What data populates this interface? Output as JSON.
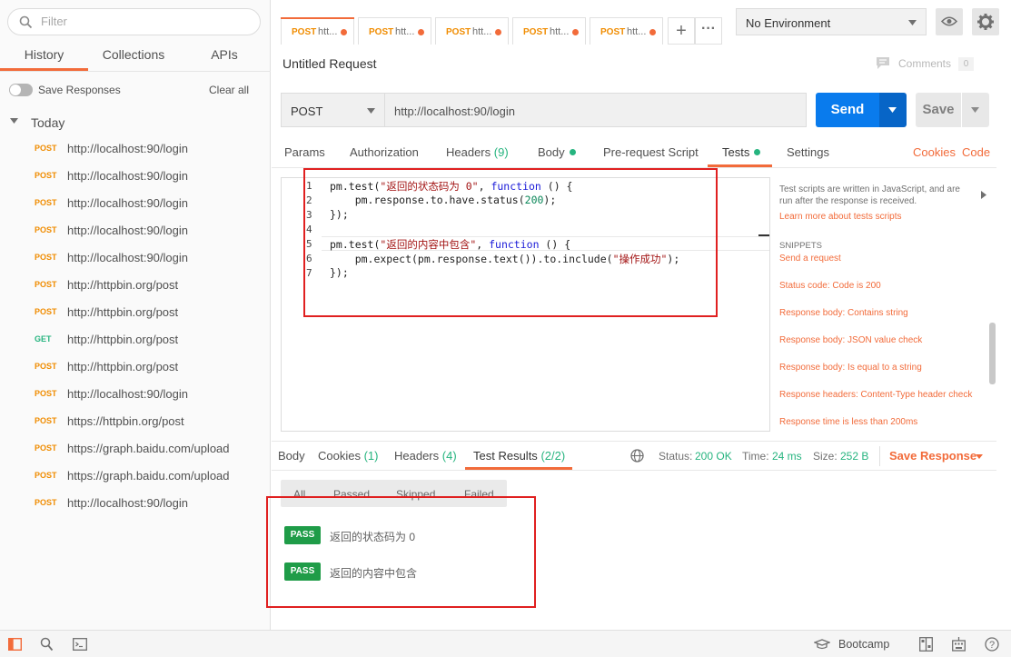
{
  "sidebar": {
    "filter_placeholder": "Filter",
    "tabs": [
      "History",
      "Collections",
      "APIs"
    ],
    "save_responses": "Save Responses",
    "clear_all": "Clear all",
    "group": "Today",
    "items": [
      {
        "method": "POST",
        "url": "http://localhost:90/login"
      },
      {
        "method": "POST",
        "url": "http://localhost:90/login"
      },
      {
        "method": "POST",
        "url": "http://localhost:90/login"
      },
      {
        "method": "POST",
        "url": "http://localhost:90/login"
      },
      {
        "method": "POST",
        "url": "http://localhost:90/login"
      },
      {
        "method": "POST",
        "url": "http://httpbin.org/post"
      },
      {
        "method": "POST",
        "url": "http://httpbin.org/post"
      },
      {
        "method": "GET",
        "url": "http://httpbin.org/post"
      },
      {
        "method": "POST",
        "url": "http://httpbin.org/post"
      },
      {
        "method": "POST",
        "url": "http://localhost:90/login"
      },
      {
        "method": "POST",
        "url": "https://httpbin.org/post"
      },
      {
        "method": "POST",
        "url": "https://graph.baidu.com/upload"
      },
      {
        "method": "POST",
        "url": "https://graph.baidu.com/upload"
      },
      {
        "method": "POST",
        "url": "http://localhost:90/login"
      }
    ]
  },
  "colors": {
    "post": "#f08c00",
    "get": "#26b47f",
    "accent": "#f26b3a",
    "send": "#097bed",
    "pass": "#1f9c48"
  },
  "tabs": [
    {
      "method": "POST",
      "label": "htt..."
    },
    {
      "method": "POST",
      "label": "htt..."
    },
    {
      "method": "POST",
      "label": "htt..."
    },
    {
      "method": "POST",
      "label": "htt..."
    },
    {
      "method": "POST",
      "label": "htt..."
    }
  ],
  "environment": "No Environment",
  "request": {
    "title": "Untitled Request",
    "comments": "Comments",
    "comments_count": "0",
    "method": "POST",
    "url": "http://localhost:90/login",
    "send": "Send",
    "save": "Save"
  },
  "request_tabs": {
    "params": "Params",
    "authorization": "Authorization",
    "headers": "Headers",
    "headers_count": "(9)",
    "body": "Body",
    "prerequest": "Pre-request Script",
    "tests": "Tests",
    "settings": "Settings",
    "cookies": "Cookies",
    "code": "Code"
  },
  "editor": {
    "line_numbers": [
      "1",
      "2",
      "3",
      "4",
      "5",
      "6",
      "7"
    ]
  },
  "snippets_panel": {
    "description": "Test scripts are written in JavaScript, and are run after the response is received.",
    "learn_more": "Learn more about tests scripts",
    "heading": "SNIPPETS",
    "items": [
      "Send a request",
      "Status code: Code is 200",
      "Response body: Contains string",
      "Response body: JSON value check",
      "Response body: Is equal to a string",
      "Response headers: Content-Type header check",
      "Response time is less than 200ms"
    ]
  },
  "response": {
    "tabs": {
      "body": "Body",
      "cookies": "Cookies",
      "cookies_count": "(1)",
      "headers": "Headers",
      "headers_count": "(4)",
      "test_results": "Test Results",
      "test_results_count": "(2/2)"
    },
    "status_label": "Status:",
    "status": "200 OK",
    "time_label": "Time:",
    "time": "24 ms",
    "size_label": "Size:",
    "size": "252 B",
    "save_response": "Save Response",
    "filters": [
      "All",
      "Passed",
      "Skipped",
      "Failed"
    ],
    "results": [
      {
        "badge": "PASS",
        "name": "返回的状态码为 0"
      },
      {
        "badge": "PASS",
        "name": "返回的内容中包含"
      }
    ]
  },
  "footer": {
    "bootcamp": "Bootcamp"
  }
}
